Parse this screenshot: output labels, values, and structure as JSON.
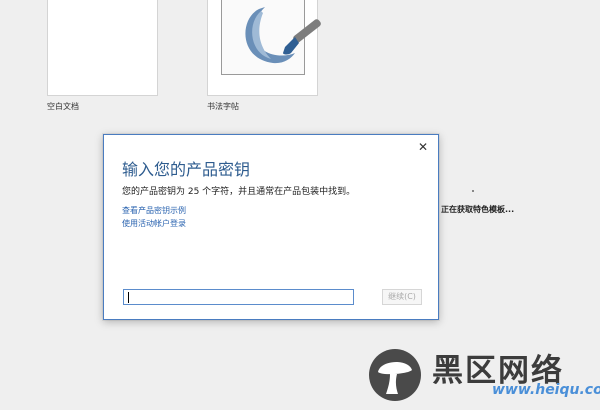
{
  "templates": [
    {
      "label": "空白文档",
      "thumb": "blank-document-thumbnail"
    },
    {
      "label": "书法字帖",
      "thumb": "calligraphy-brush-thumbnail"
    }
  ],
  "status_text": "正在获取特色模板...",
  "dialog": {
    "title": "输入您的产品密钥",
    "description": "您的产品密钥为 25 个字符，并且通常在产品包装中找到。",
    "links": [
      "查看产品密钥示例",
      "使用活动帐户登录"
    ],
    "input_value": "",
    "continue_label": "继续(C)",
    "close_icon": "close-icon"
  },
  "watermark": {
    "text": "黑区网络",
    "url": "www.heiqu.com"
  },
  "colors": {
    "accent": "#2e5c8f",
    "link": "#2b64b0",
    "dialog_border": "#4a7cc0",
    "background": "#efefef"
  }
}
